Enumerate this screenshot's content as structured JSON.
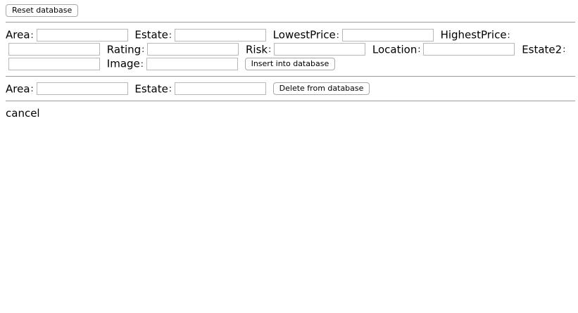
{
  "reset_button_label": "Reset database",
  "insert_form": {
    "fields": [
      {
        "label": "Area",
        "colon": ":",
        "value": "",
        "placeholder": ""
      },
      {
        "label": "Estate",
        "colon": ":",
        "value": "",
        "placeholder": ""
      },
      {
        "label": "LowestPrice",
        "colon": ":",
        "value": "",
        "placeholder": ""
      },
      {
        "label": "HighestPrice",
        "colon": ":",
        "value": "",
        "placeholder": ""
      },
      {
        "label": "Rating",
        "colon": ":",
        "value": "",
        "placeholder": ""
      },
      {
        "label": "Risk",
        "colon": ":",
        "value": "",
        "placeholder": ""
      },
      {
        "label": "Location",
        "colon": ":",
        "value": "",
        "placeholder": ""
      },
      {
        "label": "Estate2",
        "colon": ":",
        "value": "",
        "placeholder": ""
      },
      {
        "label": "Image",
        "colon": ":",
        "value": "",
        "placeholder": ""
      }
    ],
    "submit_label": "Insert into database"
  },
  "delete_form": {
    "fields": [
      {
        "label": "Area",
        "colon": ":",
        "value": "",
        "placeholder": ""
      },
      {
        "label": "Estate",
        "colon": ":",
        "value": "",
        "placeholder": ""
      }
    ],
    "submit_label": "Delete from database"
  },
  "cancel_text": "cancel"
}
